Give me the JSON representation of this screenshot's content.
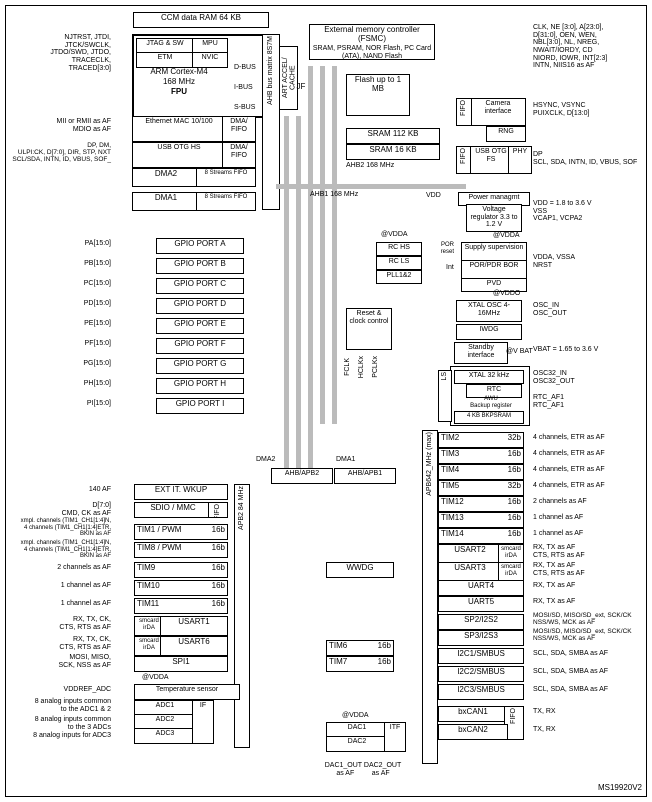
{
  "diagram_id": "MS19920V2",
  "top": {
    "ccm": "CCM data RAM 64 KB",
    "jtag_sw": "JTAG & SW",
    "mpu": "MPU",
    "etm": "ETM",
    "nvic": "NVIC",
    "cpu_line1": "ARM Cortex-M4",
    "cpu_line2": "168 MHz",
    "cpu_line3": "FPU",
    "dbus": "D-BUS",
    "ibus": "I-BUS",
    "sbus": "S-BUS",
    "fsmc_title": "External memory\ncontroller (FSMC)",
    "fsmc_sub": "SRAM, PSRAM, NOR Flash,\nPC Card (ATA), NAND Flash",
    "emac": "Ethernet MAC\n10/100",
    "dma_fifo": "DMA/\nFIFO",
    "usb_hs": "USB\nOTG HS",
    "dma2": "DMA2",
    "dma1": "DMA1",
    "dma_streams": "8 Streams\nFIFO",
    "flash": "Flash\nup to\n1 MB",
    "sram112": "SRAM 112 KB",
    "sram16": "SRAM 16 KB",
    "ahb2": "AHB2 168 MHz",
    "ahb1": "AHB1 168 MHz",
    "fifo": "FIFO",
    "usb_fs": "USB\nOTG FS",
    "phy": "PHY",
    "camera": "Camera\ninterface",
    "rng": "RNG"
  },
  "l_ext": {
    "jtag": "NJTRST, JTDI,\nJTCK/SWCLK,\nJTDO/SWD, JTDO,\nTRACECLK,\nTRACED[3:0]",
    "mii": "MII or RMII as AF\nMDIO as AF",
    "ulpi": "DP, DM,\nULPI:CK, D[7:0], DIR, STP, NXT\nSCL/SDA, INTN, ID, VBUS, SOF_",
    "pa": "PA[15:0]",
    "pb": "PB[15:0]",
    "pc": "PC[15:0]",
    "pd": "PD[15:0]",
    "pe": "PE[15:0]",
    "pf": "PF[15:0]",
    "pg": "PG[15:0]",
    "ph": "PH[15:0]",
    "pi": "PI[15:0]",
    "af140": "140 AF",
    "sdio_ext": "D[7:0]\nCMD, CK as AF",
    "tim1_ext": "xmpl. channels (TIM1_CH1[1:4]N,\n4 channels (TIM1_CH1[1:4]ETR,\nBKIN as AF",
    "tim8_ext": "xmpl. channels (TIM1_CH1[1:4]N,\n4 channels (TIM1_CH1[1:4]ETR,\nBKIN as AF",
    "ch2a": "2 channels as AF",
    "ch2b": "2 channels as AF",
    "ch1a": "1 channel as AF",
    "ch1b": "1 channel as AF",
    "usart1_ext": "RX, TX, CK,\nCTS, RTS as AF",
    "usart6_ext": "RX, TX, CK,\nCTS, RTS as AF",
    "spi1_ext": "MOSI, MISO,\nSCK, NSS as AF",
    "vddref": "VDDREF_ADC",
    "adc12": "8 analog inputs common\nto the ADC1 & 2",
    "adc_all": "8 analog inputs common\nto the 3 ADCs",
    "adc3": "8 analog inputs for ADC3"
  },
  "r_ext": {
    "fsmc": "CLK, NE [3:0], A[23:0],\nD[31:0], OEN, WEN,\nNBL[3:0], NL, NREG,\nNWAIT/IORDY, CD\nNIORD, IOWR, INT[2:3]\nINTN, NIIS16 as AF",
    "camera": "HSYNC, VSYNC\nPUIXCLK, D[13:0]",
    "usb": "DP\nSCL, SDA, INTN, ID, VBUS, SOF",
    "vdd": "VDD = 1.8 to 3.6 V\nVSS\nVCAP1, VCPA2",
    "nrst": "VDDA, VSSA\nNRST",
    "osc": "OSC_IN\nOSC_OUT",
    "vbat": "VBAT = 1.65 to 3.6 V",
    "osc32": "OSC32_IN\nOSC32_OUT",
    "rtc_af": "RTC_AF1\nRTC_AF1",
    "t2": "4 channels, ETR as AF",
    "t3": "4 channels, ETR as AF",
    "t4": "4 channels, ETR as AF",
    "t5": "4 channels, ETR as AF",
    "t12": "2 channels as AF",
    "t13": "1 channel as AF",
    "t14": "1 channel as AF",
    "u2": "RX, TX as AF\nCTS, RTS as AF",
    "u3": "RX, TX as AF\nCTS, RTS as AF",
    "u4": "RX, TX as AF",
    "u5": "RX, TX as AF",
    "sp2": "MOSI/SD, MISO/SD_ext, SCK/CK\nNSS/WS, MCK as AF",
    "sp3": "MOSI/SD, MISO/SD_ext, SCK/CK\nNSS/WS, MCK as AF",
    "i2c1": "SCL, SDA, SMBA as AF",
    "i2c2": "SCL, SDA, SMBA as AF",
    "i2c3": "SCL, SDA, SMBA as AF",
    "can": "TX, RX",
    "can2": "TX, RX"
  },
  "gpio": [
    "GPIO PORT A",
    "GPIO PORT B",
    "GPIO PORT C",
    "GPIO PORT D",
    "GPIO PORT E",
    "GPIO PORT F",
    "GPIO PORT G",
    "GPIO PORT H",
    "GPIO PORT I"
  ],
  "left_periph": {
    "exti": "EXT IT. WKUP",
    "sdio": "SDIO / MMC",
    "sdio_fifo": "FIFO",
    "tim1": "TIM1 / PWM",
    "tim8": "TIM8 / PWM",
    "tim9": "TIM9",
    "tim10": "TIM10",
    "tim11": "TIM11",
    "b16": "16b",
    "usart1": "USART1",
    "usart6": "USART6",
    "smcard": "smcard\nirDA",
    "spi1": "SPI1",
    "temp": "Temperature sensor",
    "adc1": "ADC1",
    "adc2": "ADC2",
    "adc3": "ADC3",
    "if": "IF",
    "vdda": "@VDDA"
  },
  "middle": {
    "busmatrix": "AHB bus matrix 8S7M",
    "art": "ART ACCEL/\nCACHE",
    "jf": "JF",
    "rchs": "RC HS",
    "rcls": "RC LS",
    "pll": "PLL1&2",
    "rcc": "Reset &\nclock\ncontrol",
    "fclk": "FCLK",
    "hclkx": "HCLKx",
    "pclkx": "PCLKx",
    "ahb_apb2": "AHB/APB2",
    "ahb_apb1": "AHB/APB1",
    "apb2": "APB2 84 MHz",
    "apb1": "APB642_MHz (max)",
    "dma2lbl": "DMA2",
    "dma1lbl": "DMA1",
    "wwdg": "WWDG",
    "tim6": "TIM6",
    "tim7": "TIM7",
    "dac1": "DAC1",
    "dac2": "DAC2",
    "dacif": "ITF",
    "dac_vdda": "@VDDA",
    "dac_out": "DAC1_OUT DAC2_OUT\nas AF         as AF"
  },
  "right_periph": {
    "pwrmgmt": "Power managmt",
    "vreg": "Voltage\nregulator\n3.3 to 1.2 V",
    "supply": "Supply\nsupervision",
    "por": "POR/PDR\nBOR",
    "pvd": "PVD",
    "por_label": "POR\nreset",
    "int": "Int",
    "vdd": "VDD",
    "vdda": "@VDDA",
    "vddo": "@VDDO",
    "xtal": "XTAL OSC\n4- 16MHz",
    "iwdg": "IWDG",
    "standby": "Standby\ninterface",
    "vbat": "@V BAT",
    "ls": "LS",
    "xtal32": "XTAL 32 kHz",
    "rtc": "RTC",
    "awu": "AWU",
    "bkup": "Backup register",
    "bkp": "4 KB BKPSRAM",
    "tim2": "TIM2",
    "b32": "32b",
    "tim3": "TIM3",
    "b16": "16b",
    "tim4": "TIM4",
    "tim5": "TIM5",
    "tim12": "TIM12",
    "tim13": "TIM13",
    "tim14": "TIM14",
    "usart2": "USART2",
    "usart3": "USART3",
    "smcard": "smcard\nirDA",
    "uart4": "UART4",
    "uart5": "UART5",
    "sp2": "SP2/I2S2",
    "sp3": "SP3/I2S3",
    "i2c1": "I2C1/SMBUS",
    "i2c2": "I2C2/SMBUS",
    "i2c3": "I2C3/SMBUS",
    "can1": "bxCAN1",
    "can2": "bxCAN2",
    "fifo": "FIFO"
  }
}
